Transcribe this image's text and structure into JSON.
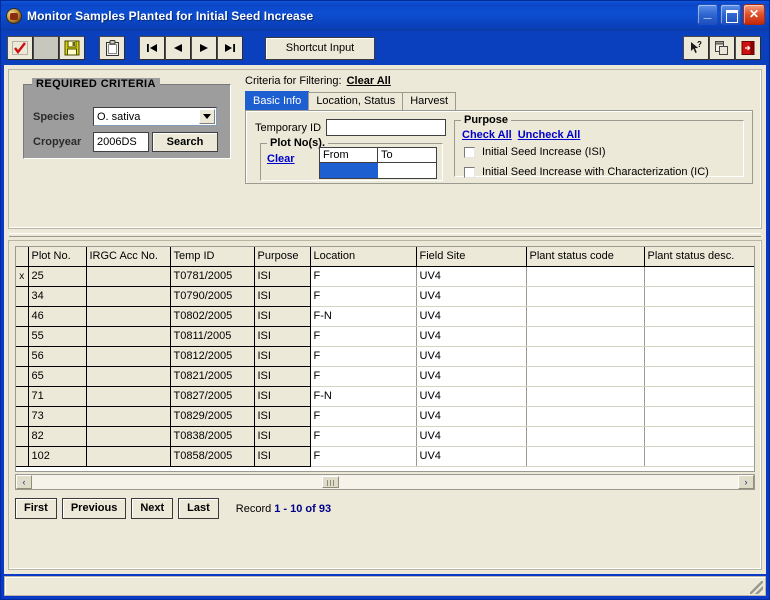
{
  "window": {
    "title": "Monitor Samples Planted for Initial Seed Increase",
    "app_icon": "rice-grain-icon",
    "minimize_label": "_",
    "maximize_label": "",
    "close_label": "✕"
  },
  "toolbar": {
    "buttons": [
      {
        "name": "confirm-check-button",
        "icon": "red-check-icon",
        "enabled": true
      },
      {
        "name": "blank-button",
        "icon": "blank-icon",
        "enabled": false
      },
      {
        "name": "save-button",
        "icon": "floppy-disk-icon",
        "enabled": true
      },
      {
        "name": "clipboard-button",
        "icon": "clipboard-icon",
        "enabled": true
      },
      {
        "name": "first-record-button",
        "icon": "first-arrow-icon",
        "enabled": true
      },
      {
        "name": "previous-record-button",
        "icon": "previous-arrow-icon",
        "enabled": true
      },
      {
        "name": "next-record-button",
        "icon": "next-arrow-icon",
        "enabled": true
      },
      {
        "name": "last-record-button",
        "icon": "last-arrow-icon",
        "enabled": true
      }
    ],
    "shortcut_label": "Shortcut Input",
    "right_buttons": [
      {
        "name": "help-button",
        "icon": "help-arrow-icon"
      },
      {
        "name": "copy-button",
        "icon": "copy-windows-icon"
      },
      {
        "name": "exit-button",
        "icon": "exit-door-icon"
      }
    ]
  },
  "required_criteria": {
    "legend": "REQUIRED  CRITERIA",
    "species_label": "Species",
    "species_value": "O. sativa",
    "cropyear_label": "Cropyear",
    "cropyear_value": "2006DS",
    "search_label": "Search"
  },
  "filter": {
    "header_label": "Criteria for Filtering:",
    "clear_all_label": "Clear All",
    "tabs": [
      {
        "label": "Basic Info",
        "active": true
      },
      {
        "label": "Location, Status",
        "active": false
      },
      {
        "label": "Harvest",
        "active": false
      }
    ],
    "temp_id_label": "Temporary ID",
    "temp_id_value": "",
    "temp_id_placeholder": "",
    "plot_nos": {
      "legend": "Plot No(s).",
      "clear_label": "Clear",
      "col_from": "From",
      "col_to": "To",
      "from_value": "",
      "to_value": ""
    },
    "purpose": {
      "legend": "Purpose",
      "check_all_label": "Check All",
      "uncheck_all_label": "Uncheck All",
      "options": [
        {
          "label": "Initial Seed Increase (ISI)",
          "checked": false
        },
        {
          "label": "Initial Seed Increase with Characterization (IC)",
          "checked": false
        }
      ]
    }
  },
  "grid": {
    "columns": [
      "Plot No.",
      "IRGC Acc No.",
      "Temp ID",
      "Purpose",
      "Location",
      "Field Site",
      "Plant status code",
      "Plant status desc."
    ],
    "rows": [
      {
        "marker": "x",
        "plot_no": "25",
        "irgc": "",
        "temp_id": "T0781/2005",
        "purpose": "ISI",
        "location": "F",
        "field_site": "UV4",
        "status_code": "",
        "status_desc": ""
      },
      {
        "marker": "",
        "plot_no": "34",
        "irgc": "",
        "temp_id": "T0790/2005",
        "purpose": "ISI",
        "location": "F",
        "field_site": "UV4",
        "status_code": "",
        "status_desc": ""
      },
      {
        "marker": "",
        "plot_no": "46",
        "irgc": "",
        "temp_id": "T0802/2005",
        "purpose": "ISI",
        "location": "F-N",
        "field_site": "UV4",
        "status_code": "",
        "status_desc": ""
      },
      {
        "marker": "",
        "plot_no": "55",
        "irgc": "",
        "temp_id": "T0811/2005",
        "purpose": "ISI",
        "location": "F",
        "field_site": "UV4",
        "status_code": "",
        "status_desc": ""
      },
      {
        "marker": "",
        "plot_no": "56",
        "irgc": "",
        "temp_id": "T0812/2005",
        "purpose": "ISI",
        "location": "F",
        "field_site": "UV4",
        "status_code": "",
        "status_desc": ""
      },
      {
        "marker": "",
        "plot_no": "65",
        "irgc": "",
        "temp_id": "T0821/2005",
        "purpose": "ISI",
        "location": "F",
        "field_site": "UV4",
        "status_code": "",
        "status_desc": ""
      },
      {
        "marker": "",
        "plot_no": "71",
        "irgc": "",
        "temp_id": "T0827/2005",
        "purpose": "ISI",
        "location": "F-N",
        "field_site": "UV4",
        "status_code": "",
        "status_desc": ""
      },
      {
        "marker": "",
        "plot_no": "73",
        "irgc": "",
        "temp_id": "T0829/2005",
        "purpose": "ISI",
        "location": "F",
        "field_site": "UV4",
        "status_code": "",
        "status_desc": ""
      },
      {
        "marker": "",
        "plot_no": "82",
        "irgc": "",
        "temp_id": "T0838/2005",
        "purpose": "ISI",
        "location": "F",
        "field_site": "UV4",
        "status_code": "",
        "status_desc": ""
      },
      {
        "marker": "",
        "plot_no": "102",
        "irgc": "",
        "temp_id": "T0858/2005",
        "purpose": "ISI",
        "location": "F",
        "field_site": "UV4",
        "status_code": "",
        "status_desc": ""
      }
    ]
  },
  "navigation": {
    "first_label": "First",
    "previous_label": "Previous",
    "next_label": "Next",
    "last_label": "Last",
    "record_label": "Record",
    "record_value": "1 - 10 of 93"
  },
  "scrollbar": {
    "left_arrow": "‹",
    "right_arrow": "›"
  },
  "colors": {
    "title_bar": "#0a3fb8",
    "accent_blue": "#1d5fd0",
    "form_bg": "#ece9d8",
    "required_box_bg": "#9d9d9d",
    "link_blue": "#0000cc",
    "record_blue": "#00008b"
  }
}
